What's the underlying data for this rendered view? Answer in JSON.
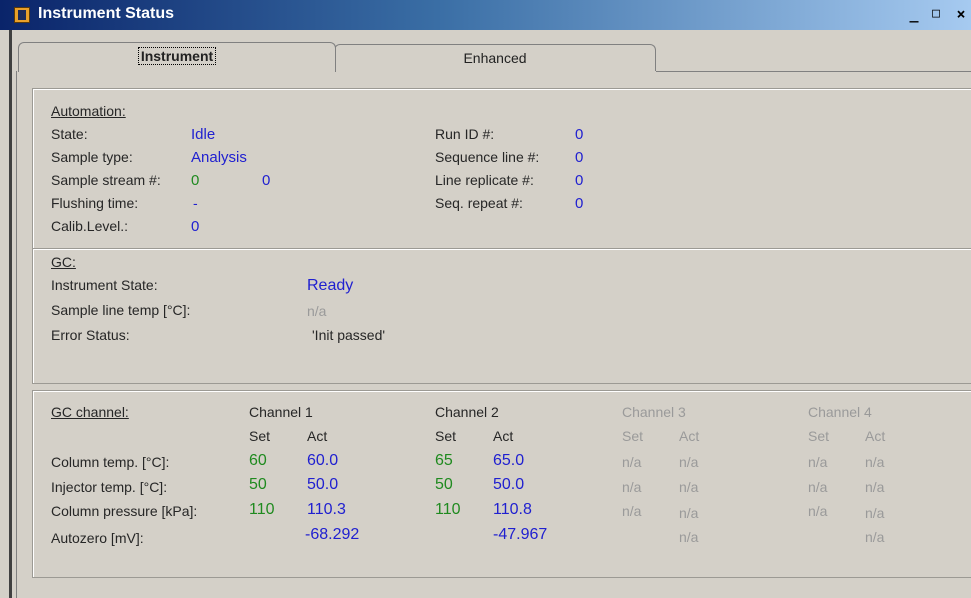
{
  "window": {
    "title": "Instrument Status",
    "minimize": "_",
    "maximize": "□",
    "close": "×"
  },
  "tabs": [
    "Instrument",
    "Enhanced"
  ],
  "automation": {
    "header": "Automation:",
    "rows": [
      {
        "label": "State:",
        "value": "Idle"
      },
      {
        "label": "Sample type:",
        "value": "Analysis"
      },
      {
        "label": "Sample stream #:",
        "value": "0",
        "value2": "0"
      },
      {
        "label": "Flushing time:",
        "value": "-"
      },
      {
        "label": "Calib.Level.:",
        "value": "0"
      }
    ],
    "right_rows": [
      {
        "label": "Run ID #:",
        "value": "0"
      },
      {
        "label": "Sequence line #:",
        "value": "0"
      },
      {
        "label": "Line replicate #:",
        "value": "0"
      },
      {
        "label": "Seq. repeat #:",
        "value": "0"
      }
    ]
  },
  "gc": {
    "header": "GC:",
    "rows": [
      {
        "label": "Instrument State:",
        "value": "Ready"
      },
      {
        "label": "Sample line temp [°C]:",
        "value": "n/a"
      },
      {
        "label": "Error Status:",
        "value": "'Init passed'"
      }
    ]
  },
  "gc_channel": {
    "header": "GC channel:",
    "set_label": "Set",
    "act_label": "Act",
    "channels": [
      "Channel 1",
      "Channel 2",
      "Channel 3",
      "Channel 4"
    ],
    "rows": [
      {
        "label": "Column temp. [°C]:",
        "vals": [
          "60",
          "60.0",
          "65",
          "65.0",
          "n/a",
          "n/a",
          "n/a",
          "n/a"
        ]
      },
      {
        "label": "Injector temp. [°C]:",
        "vals": [
          "50",
          "50.0",
          "50",
          "50.0",
          "n/a",
          "n/a",
          "n/a",
          "n/a"
        ]
      },
      {
        "label": "Column pressure [kPa]:",
        "vals": [
          "110",
          "110.3",
          "110",
          "110.8",
          "n/a",
          "n/a",
          "n/a",
          "n/a"
        ]
      },
      {
        "label": "Autozero [mV]:",
        "vals": [
          "",
          "-68.292",
          "",
          "-47.967",
          "",
          "n/a",
          "",
          "n/a"
        ]
      }
    ]
  }
}
